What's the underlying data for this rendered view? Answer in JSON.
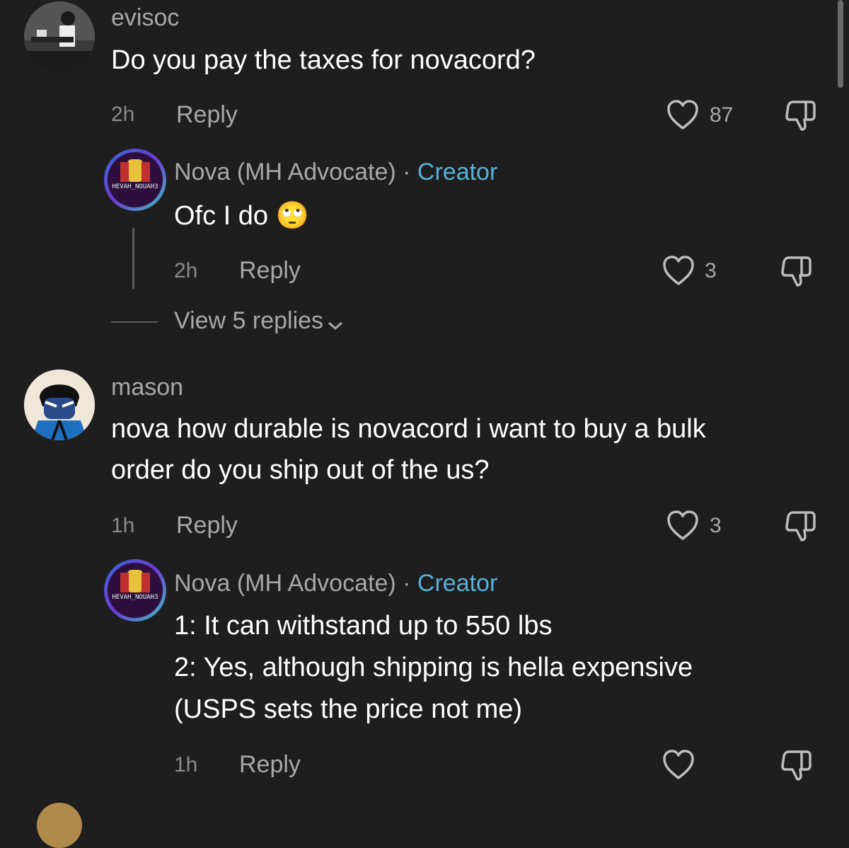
{
  "comments": [
    {
      "username": "evisoc",
      "text": "Do you pay the taxes for novacord?",
      "time": "2h",
      "reply_label": "Reply",
      "likes": "87",
      "reply": {
        "username": "Nova (MH Advocate)",
        "separator": "·",
        "badge": "Creator",
        "text": "Ofc I do 🙄",
        "time": "2h",
        "reply_label": "Reply",
        "likes": "3",
        "avatar_text": "HEVAH_NOUAH3"
      },
      "view_replies": "View 5 replies"
    },
    {
      "username": "mason",
      "text_line1": "nova how durable is novacord i want to buy a bulk",
      "text_line2": "order do you ship out of the us?",
      "time": "1h",
      "reply_label": "Reply",
      "likes": "3",
      "reply": {
        "username": "Nova (MH Advocate)",
        "separator": "·",
        "badge": "Creator",
        "line1": "1: It can withstand up to 550 lbs",
        "line2": "2: Yes, although shipping is hella expensive",
        "line3": "(USPS sets the price not me)",
        "time": "1h",
        "reply_label": "Reply",
        "avatar_text": "HEVAH_NOUAH3"
      }
    }
  ],
  "colors": {
    "background": "#1e1e1e",
    "creator": "#5ab0d6",
    "muted": "#a8a8a8"
  }
}
